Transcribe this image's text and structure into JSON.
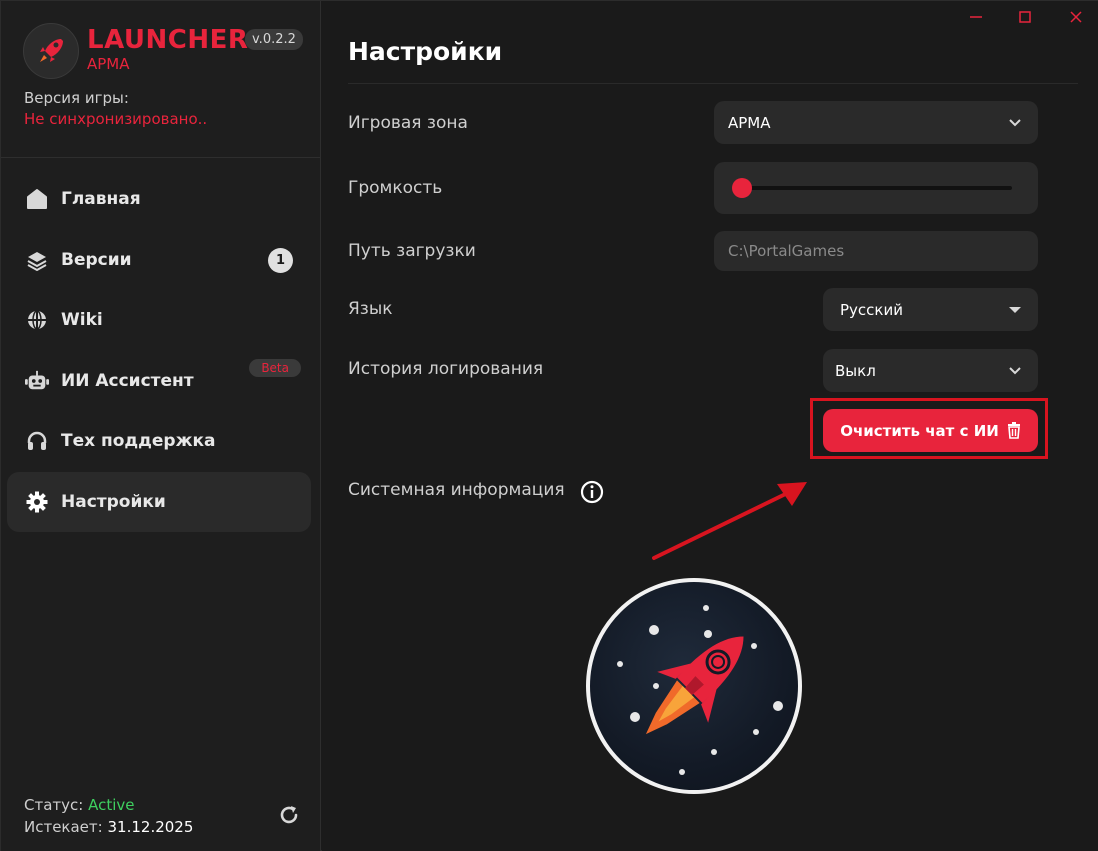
{
  "app": {
    "brand_name": "LAUNCHER",
    "brand_sub": "APMA",
    "version": "v.0.2.2",
    "game_version_label": "Версия игры:",
    "game_version_value": "Не синхронизировано..",
    "accent_color": "#e8243c"
  },
  "sidebar": {
    "items": [
      {
        "label": "Главная",
        "icon": "home-icon"
      },
      {
        "label": "Версии",
        "icon": "layers-icon",
        "badge": "1"
      },
      {
        "label": "Wiki",
        "icon": "globe-icon"
      },
      {
        "label": "ИИ Ассистент",
        "icon": "robot-icon",
        "tag": "Beta"
      },
      {
        "label": "Тех поддержка",
        "icon": "headphones-icon"
      },
      {
        "label": "Настройки",
        "icon": "gear-icon",
        "active": true
      }
    ],
    "status_label": "Статус:",
    "status_value": "Active",
    "expires_label": "Истекает:",
    "expires_value": "31.12.2025",
    "status_color": "#3ecf5f"
  },
  "main": {
    "title": "Настройки",
    "settings": {
      "zone_label": "Игровая зона",
      "zone_value": "APMA",
      "volume_label": "Громкость",
      "volume_level": 0.0,
      "path_label": "Путь загрузки",
      "path_placeholder": "C:\\PortalGames",
      "language_label": "Язык",
      "language_value": "Русский",
      "logging_label": "История логирования",
      "logging_value": "Выкл",
      "clear_chat_label": "Очистить чат с ИИ",
      "sysinfo_label": "Системная информация"
    }
  }
}
